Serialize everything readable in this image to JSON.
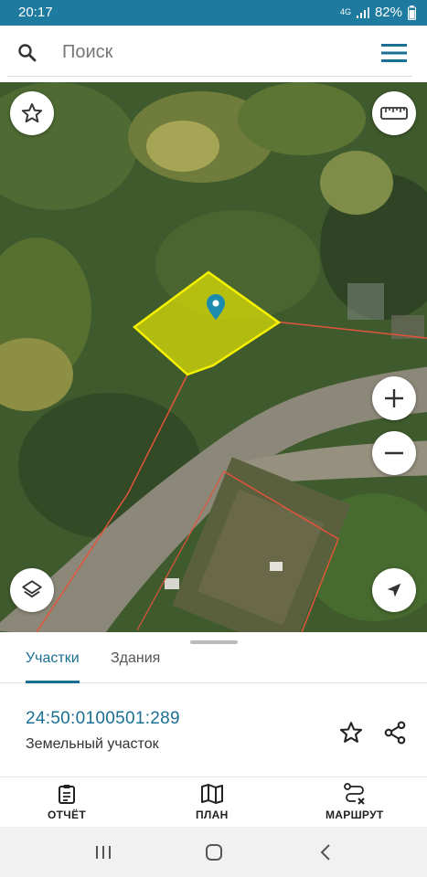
{
  "status": {
    "time": "20:17",
    "network": "4G",
    "battery": "82%"
  },
  "search": {
    "placeholder": "Поиск"
  },
  "map": {
    "layer": "satellite"
  },
  "sheet": {
    "tabs": [
      {
        "label": "Участки",
        "active": true
      },
      {
        "label": "Здания",
        "active": false
      }
    ],
    "parcel": {
      "number": "24:50:0100501:289",
      "type": "Земельный участок"
    }
  },
  "actions": [
    {
      "label": "ОТЧЁТ",
      "icon": "clipboard-icon"
    },
    {
      "label": "ПЛАН",
      "icon": "map-icon"
    },
    {
      "label": "МАРШРУТ",
      "icon": "route-icon"
    }
  ],
  "colors": {
    "accent": "#1a6f93",
    "status_bar": "#1e7a9e",
    "parcel_fill": "#f0f000",
    "boundary": "#e2543b"
  }
}
